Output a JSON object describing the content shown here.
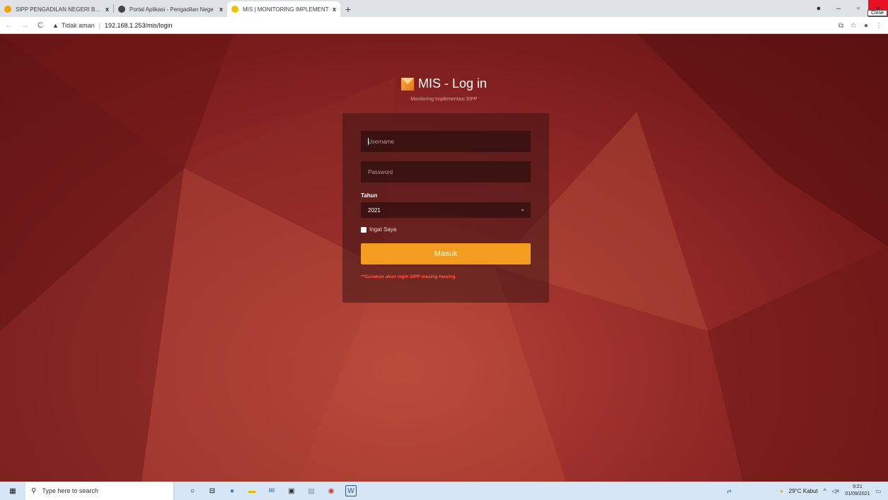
{
  "browser": {
    "tabs": [
      {
        "label": "SIPP PENGADILAN NEGERI BANT",
        "close": "x",
        "color": "#f0a500"
      },
      {
        "label": "Portal Aplikasi - Pengadilan Nege",
        "close": "x",
        "color": "#444444"
      },
      {
        "label": "MIS | MONITORING IMPLEMENT",
        "close": "x",
        "color": "#f0c300"
      }
    ],
    "new_tab": "+",
    "window_controls": {
      "minimize": "–",
      "maximize": "▫",
      "close": "✕",
      "close_tooltip": "Close"
    },
    "address": {
      "back": "←",
      "forward": "→",
      "reload": "C",
      "security_icon": "▲",
      "security_text": "Tidak aman",
      "url": "192.168.1.253/mis/login"
    }
  },
  "login": {
    "title": "MIS - Log in",
    "subtitle": "Monitoring Implementasi SIPP",
    "username_placeholder": "Username",
    "password_placeholder": "Password",
    "year_label": "Tahun",
    "year_value": "2021",
    "remember_label": "Ingat Saya",
    "submit_label": "Masuk",
    "note": "**Gunakan akun login SIPP masing-masing."
  },
  "taskbar": {
    "search_placeholder": "Type here to search",
    "weather": "29°C  Kabut",
    "time": "9:21",
    "date": "01/09/2021"
  },
  "colors": {
    "accent": "#f39c1f",
    "note": "#ff5a4a",
    "background": "#7a1a1a"
  }
}
